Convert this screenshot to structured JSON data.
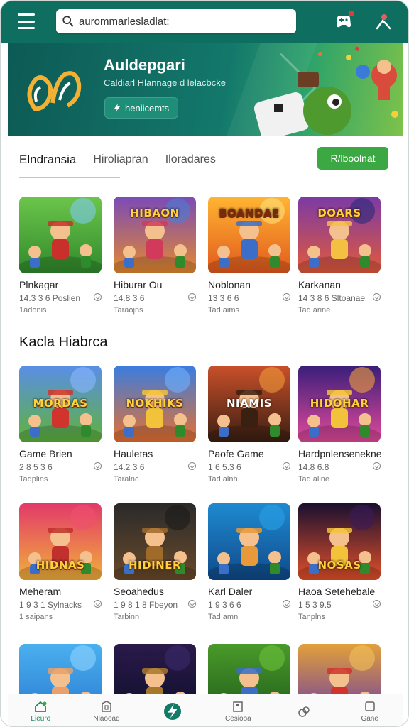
{
  "header": {
    "search_value": "aurommarlesladlat:",
    "search_placeholder": "aurommarlesladlat:"
  },
  "banner": {
    "title": "Auldepgari",
    "subtitle": "Caldiarl Hlannage d lelacbcke",
    "button_label": "heniicemts"
  },
  "tabs": [
    {
      "label": "Elndransia",
      "active": true
    },
    {
      "label": "Hiroliapran",
      "active": false
    },
    {
      "label": "Iloradares",
      "active": false
    }
  ],
  "cta_label": "R/lboolnat",
  "section_title": "Kacla Hiabrca",
  "rows": [
    [
      {
        "name": "Plnkagar",
        "meta": "14.3 3 6 Poslien",
        "tag": "1adonis",
        "art": "art-green"
      },
      {
        "name": "Hiburar Ou",
        "meta": "14.8 3 6",
        "tag": "Taraojns",
        "art": "art-hibaon",
        "art_text": "HIBAON"
      },
      {
        "name": "Noblonan",
        "meta": "13 3 6 6",
        "tag": "Tad aims",
        "art": "art-orange",
        "art_text": "BOANDAE"
      },
      {
        "name": "Karkanan",
        "meta": "14 3 8 6 Sltoanae",
        "tag": "Tad arine",
        "art": "art-crowd",
        "art_text": "DOARS"
      }
    ],
    [
      {
        "name": "Game Brien",
        "meta": "2 8 5 3 6",
        "tag": "Tadplins",
        "art": "art-field",
        "art_text": "MORDAS"
      },
      {
        "name": "Hauletas",
        "meta": "14.2 3 6",
        "tag": "Taralnc",
        "art": "art-party",
        "art_text": "NOKHIKS"
      },
      {
        "name": "Paofe Game",
        "meta": "1 6 5.3 6",
        "tag": "Tad alnh",
        "art": "art-sunset",
        "art_text": "NIAMIS"
      },
      {
        "name": "Hardpnlensenekne",
        "meta": "14.8 6.8",
        "tag": "Tad aline",
        "art": "art-stage",
        "art_text": "HIDOHAR"
      }
    ],
    [
      {
        "name": "Meheram",
        "meta": "1 9 3 1 Sylnacks",
        "tag": "1 saipans",
        "art": "art-hero",
        "art_text": "HIDNAS"
      },
      {
        "name": "Seoahedus",
        "meta": "1 9 8 1 8 Fbeyon",
        "tag": "Tarbinn",
        "art": "art-dark",
        "art_text": "HIDINER"
      },
      {
        "name": "Karl Daler",
        "meta": "1 9 3 6 6",
        "tag": "Tad amn",
        "art": "art-bear"
      },
      {
        "name": "Haoa Setehebale",
        "meta": "1 5 3 9.5",
        "tag": "Tanplns",
        "art": "art-neon",
        "art_text": "NOSAS"
      }
    ],
    [
      {
        "name": "",
        "meta": "",
        "tag": "",
        "art": "art-sky"
      },
      {
        "name": "",
        "meta": "",
        "tag": "",
        "art": "art-night"
      },
      {
        "name": "",
        "meta": "",
        "tag": "",
        "art": "art-jungle"
      },
      {
        "name": "",
        "meta": "",
        "tag": "",
        "art": "art-castle"
      }
    ]
  ],
  "bottom_nav": [
    {
      "label": "Lieuro",
      "icon": "home-icon",
      "active": true
    },
    {
      "label": "Nlaooad",
      "icon": "building-icon",
      "active": false
    },
    {
      "label": "",
      "icon": "bolt-icon",
      "active": false
    },
    {
      "label": "Cesiooa",
      "icon": "store-icon",
      "active": false
    },
    {
      "label": "",
      "icon": "people-icon",
      "active": false
    },
    {
      "label": "Gane",
      "icon": "square-icon",
      "active": false
    }
  ],
  "colors": {
    "header": "#0e6f61",
    "accent_green": "#3ca843",
    "nav_active": "#1a8a5a"
  }
}
